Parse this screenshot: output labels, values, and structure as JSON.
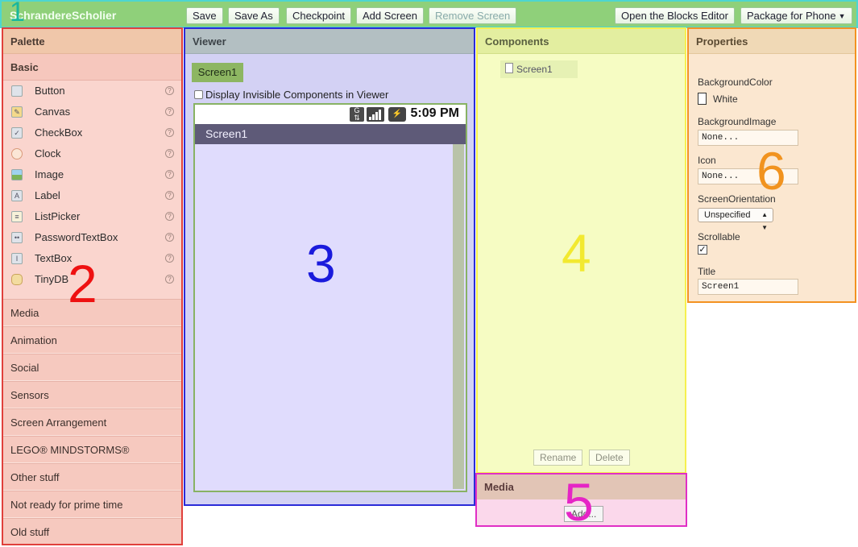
{
  "toolbar": {
    "app_title": "SchrandereScholier",
    "buttons": {
      "save": "Save",
      "save_as": "Save As",
      "checkpoint": "Checkpoint",
      "add_screen": "Add Screen",
      "remove_screen": "Remove Screen",
      "open_blocks": "Open the Blocks Editor",
      "package": "Package for Phone"
    }
  },
  "palette": {
    "title": "Palette",
    "basic_label": "Basic",
    "components": [
      {
        "label": "Button",
        "icon": "button-icon"
      },
      {
        "label": "Canvas",
        "icon": "canvas-icon"
      },
      {
        "label": "CheckBox",
        "icon": "checkbox-icon"
      },
      {
        "label": "Clock",
        "icon": "clock-icon"
      },
      {
        "label": "Image",
        "icon": "image-icon"
      },
      {
        "label": "Label",
        "icon": "label-icon"
      },
      {
        "label": "ListPicker",
        "icon": "listpicker-icon"
      },
      {
        "label": "PasswordTextBox",
        "icon": "password-icon"
      },
      {
        "label": "TextBox",
        "icon": "textbox-icon"
      },
      {
        "label": "TinyDB",
        "icon": "database-icon"
      }
    ],
    "help_glyph": "?",
    "categories": [
      "Media",
      "Animation",
      "Social",
      "Sensors",
      "Screen Arrangement",
      "LEGO® MINDSTORMS®",
      "Other stuff",
      "Not ready for prime time",
      "Old stuff"
    ]
  },
  "viewer": {
    "title": "Viewer",
    "screen_tab": "Screen1",
    "invisible_label": "Display Invisible Components in Viewer",
    "status_time": "5:09 PM",
    "screen_title": "Screen1"
  },
  "components": {
    "title": "Components",
    "tree_item": "Screen1",
    "rename": "Rename",
    "delete": "Delete"
  },
  "media": {
    "title": "Media",
    "add": "Add..."
  },
  "properties": {
    "title": "Properties",
    "background_color_label": "BackgroundColor",
    "background_color_value": "White",
    "background_image_label": "BackgroundImage",
    "background_image_value": "None...",
    "icon_label": "Icon",
    "icon_value": "None...",
    "orientation_label": "ScreenOrientation",
    "orientation_value": "Unspecified",
    "scrollable_label": "Scrollable",
    "scrollable_checked": true,
    "title_label": "Title",
    "title_value": "Screen1"
  },
  "annotations": {
    "a1": "1",
    "a2": "2",
    "a3": "3",
    "a4": "4",
    "a5": "5",
    "a6": "6"
  },
  "colors": {
    "toolbar": "#8fd07a",
    "palette": "#f9d3cb",
    "viewer": "#d3d1f4",
    "components": "#f6fcc3",
    "media": "#fbd8eb",
    "properties": "#fbe7d0"
  }
}
